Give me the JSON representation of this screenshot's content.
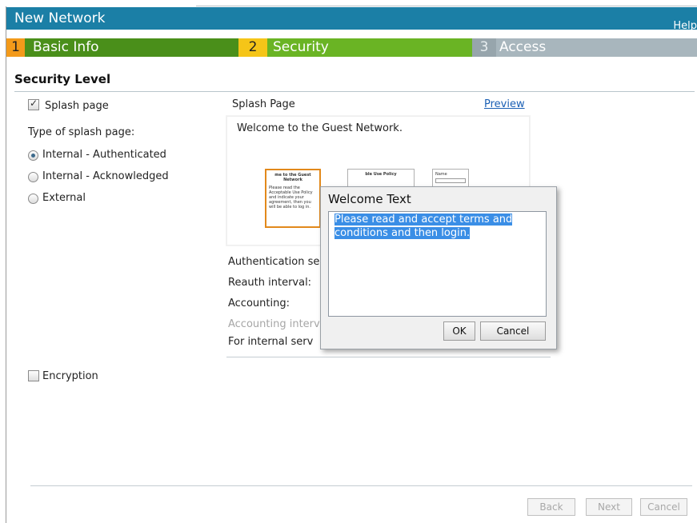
{
  "window": {
    "title": "New Network",
    "help": "Help"
  },
  "steps": [
    {
      "num": "1",
      "label": "Basic Info"
    },
    {
      "num": "2",
      "label": "Security"
    },
    {
      "num": "3",
      "label": "Access"
    }
  ],
  "section_title": "Security Level",
  "splash_checkbox": {
    "label": "Splash page",
    "checked": true
  },
  "splash_type": {
    "label": "Type of splash page:",
    "options": [
      "Internal - Authenticated",
      "Internal - Acknowledged",
      "External"
    ],
    "selected": "Internal - Authenticated"
  },
  "splash_page": {
    "heading": "Splash Page",
    "preview_link": "Preview",
    "welcome": "Welcome to the Guest Network.",
    "thumb1_title": "me to the Guest Network",
    "thumb1_body": "Please read the Acceptable Use Policy and indicate your agreement, then you will be able to log in.",
    "thumb2_title": "ble Use Policy",
    "thumb3_label": "Name"
  },
  "form_fields": [
    "Authentication se",
    "Reauth interval:",
    "Accounting:",
    "Accounting interv",
    "For internal serv"
  ],
  "encryption": {
    "label": "Encryption",
    "checked": false
  },
  "nav_buttons": {
    "back": "Back",
    "next": "Next",
    "cancel": "Cancel"
  },
  "dialog": {
    "title": "Welcome Text",
    "text_line1": "Please read and accept terms and",
    "text_line2": "conditions and then login.",
    "ok": "OK",
    "cancel": "Cancel"
  }
}
